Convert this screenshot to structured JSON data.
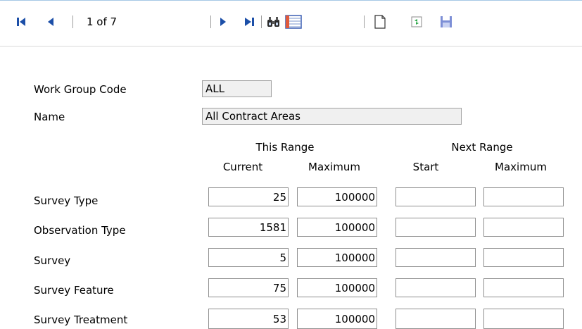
{
  "toolbar": {
    "page_indicator": "1 of 7",
    "buttons": [
      "first-record",
      "previous-record",
      "next-record",
      "last-record",
      "find",
      "list-view",
      "new-record",
      "copy-record",
      "save-record"
    ]
  },
  "form": {
    "work_group_code_label": "Work Group Code",
    "work_group_code_value": "ALL",
    "name_label": "Name",
    "name_value": "All Contract Areas"
  },
  "ranges": {
    "this_range_label": "This Range",
    "next_range_label": "Next Range",
    "col_current": "Current",
    "col_maximum": "Maximum",
    "col_start": "Start",
    "col_next_maximum": "Maximum"
  },
  "rows": [
    {
      "label": "Survey Type",
      "current": "25",
      "maximum": "100000",
      "next_start": "",
      "next_maximum": ""
    },
    {
      "label": "Observation Type",
      "current": "1581",
      "maximum": "100000",
      "next_start": "",
      "next_maximum": ""
    },
    {
      "label": "Survey",
      "current": "5",
      "maximum": "100000",
      "next_start": "",
      "next_maximum": ""
    },
    {
      "label": "Survey Feature",
      "current": "75",
      "maximum": "100000",
      "next_start": "",
      "next_maximum": ""
    },
    {
      "label": "Survey Treatment",
      "current": "53",
      "maximum": "100000",
      "next_start": "",
      "next_maximum": ""
    }
  ],
  "colors": {
    "nav_blue": "#1c4fa8",
    "field_background": "#f0f0f0",
    "border": "#8e8e8e"
  }
}
